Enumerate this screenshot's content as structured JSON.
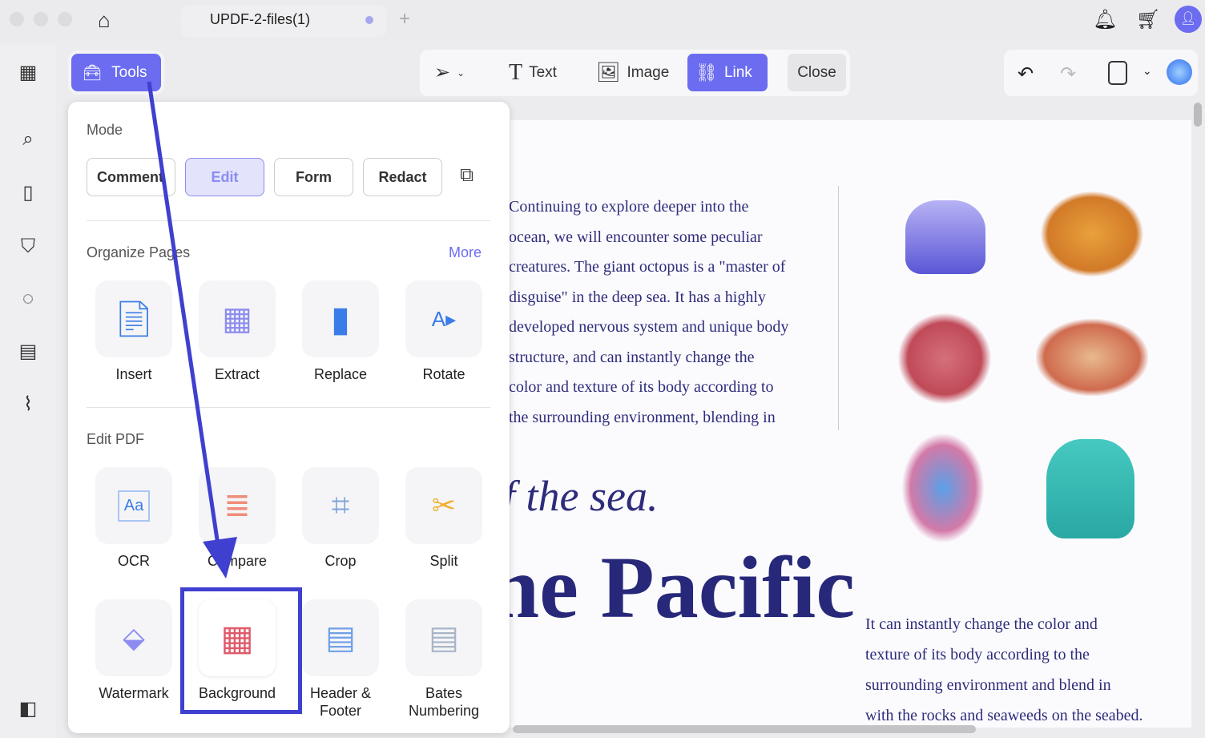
{
  "window": {
    "tab_title": "UPDF-2-files(1)",
    "new_tab": "+"
  },
  "toolbar": {
    "tools_label": "Tools",
    "text_label": "Text",
    "image_label": "Image",
    "link_label": "Link",
    "close_label": "Close"
  },
  "popup": {
    "mode_heading": "Mode",
    "modes": [
      "Comment",
      "Edit",
      "Form",
      "Redact"
    ],
    "active_mode": "Edit",
    "organize_heading": "Organize Pages",
    "more_label": "More",
    "organize_tools": [
      "Insert",
      "Extract",
      "Replace",
      "Rotate"
    ],
    "edit_heading": "Edit PDF",
    "edit_tools_row1": [
      "OCR",
      "Compare",
      "Crop",
      "Split"
    ],
    "edit_tools_row2": [
      "Watermark",
      "Background",
      "Header & Footer",
      "Bates Numbering"
    ],
    "highlighted_tool": "Background"
  },
  "document": {
    "left_paragraph": [
      "Continuing to explore deeper into the",
      "ocean, we will encounter some peculiar",
      "creatures. The giant octopus is a \"master of",
      "disguise\" in the deep sea. It has a highly",
      "developed nervous system and unique body",
      "structure, and can instantly change the",
      "color and texture of its body according to",
      "the surrounding environment, blending in"
    ],
    "subtitle": "f the sea.",
    "title": "he Pacific",
    "right_paragraph": [
      "It can instantly change the color and",
      "texture of its body according to the",
      "surrounding environment and blend in",
      "with the rocks and seaweeds on the seabed."
    ]
  },
  "colors": {
    "accent": "#6b6cf0",
    "arrow": "#3f3fd0",
    "doc_text": "#2e2c7a"
  }
}
